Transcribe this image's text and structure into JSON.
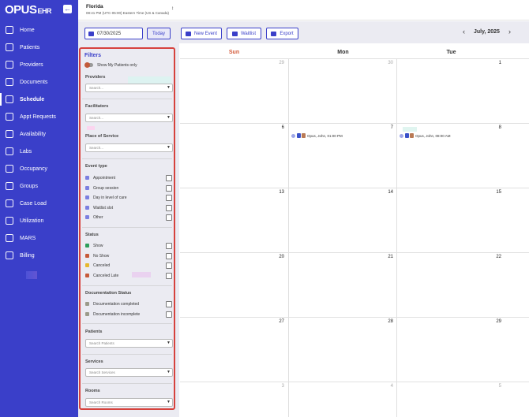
{
  "sidebar": {
    "logo": "OPUS",
    "logo_suffix": "EHR",
    "collapse_icon": "arrow-left-icon",
    "items": [
      {
        "label": "Home",
        "icon": "home-icon"
      },
      {
        "label": "Patients",
        "icon": "patients-icon"
      },
      {
        "label": "Providers",
        "icon": "providers-icon"
      },
      {
        "label": "Documents",
        "icon": "documents-icon"
      },
      {
        "label": "Schedule",
        "icon": "calendar-icon",
        "active": true
      },
      {
        "label": "Appt Requests",
        "icon": "appt-requests-icon"
      },
      {
        "label": "Availability",
        "icon": "clock-icon"
      },
      {
        "label": "Labs",
        "icon": "flask-icon"
      },
      {
        "label": "Occupancy",
        "icon": "bed-icon"
      },
      {
        "label": "Groups",
        "icon": "groups-icon"
      },
      {
        "label": "Case Load",
        "icon": "case-load-icon"
      },
      {
        "label": "Utilization",
        "icon": "utilization-icon"
      },
      {
        "label": "MARS",
        "icon": "pill-icon"
      },
      {
        "label": "Billing",
        "icon": "billing-icon"
      }
    ]
  },
  "header": {
    "location": "Florida",
    "time": "08:41 PM (UTC-05:00) Eastern Time (US & Canada)"
  },
  "toolbar": {
    "date": "07/30/2025",
    "today": "Today",
    "new_event": "New Event",
    "waitlist": "Waitlist",
    "export": "Export",
    "month": "July, 2025"
  },
  "filters": {
    "title": "Filters",
    "show_my_patients": "Show My Patients only",
    "providers": {
      "label": "Providers",
      "placeholder": "Search..."
    },
    "facilitators": {
      "label": "Facilitators",
      "placeholder": "Search..."
    },
    "place_of_service": {
      "label": "Place of Service",
      "placeholder": "Search..."
    },
    "event_type": {
      "label": "Event type",
      "items": [
        {
          "label": "Appointment",
          "color": "#7b7fe0"
        },
        {
          "label": "Group session",
          "color": "#7b7fe0"
        },
        {
          "label": "Day in level of care",
          "color": "#7b7fe0"
        },
        {
          "label": "Waitlist slot",
          "color": "#7b7fe0"
        },
        {
          "label": "Other",
          "color": "#7b7fe0"
        }
      ]
    },
    "status": {
      "label": "Status",
      "items": [
        {
          "label": "Show",
          "color": "#2e9e5b"
        },
        {
          "label": "No Show",
          "color": "#c65a3a"
        },
        {
          "label": "Canceled",
          "color": "#e6b82e"
        },
        {
          "label": "Canceled Late",
          "color": "#c65a3a"
        }
      ]
    },
    "documentation_status": {
      "label": "Documentation Status",
      "items": [
        {
          "label": "Documentation completed",
          "color": "#9b9b8a"
        },
        {
          "label": "Documentation incomplete",
          "color": "#9b9b8a"
        }
      ]
    },
    "patients": {
      "label": "Patients",
      "placeholder": "Search Patients"
    },
    "services": {
      "label": "Services",
      "placeholder": "Search Services"
    },
    "rooms": {
      "label": "Rooms",
      "placeholder": "Search Rooms"
    }
  },
  "calendar": {
    "days_of_week": [
      {
        "label": "Sun",
        "color": "#d35a3a"
      },
      {
        "label": "Mon",
        "color": "#333333"
      },
      {
        "label": "Tue",
        "color": "#333333"
      }
    ],
    "weeks": [
      [
        {
          "day": "29",
          "muted": true
        },
        {
          "day": "30",
          "muted": true
        },
        {
          "day": "1",
          "muted": false
        }
      ],
      [
        {
          "day": "6",
          "muted": false
        },
        {
          "day": "7",
          "muted": false
        },
        {
          "day": "8",
          "muted": false
        }
      ],
      [
        {
          "day": "13",
          "muted": false
        },
        {
          "day": "14",
          "muted": false
        },
        {
          "day": "15",
          "muted": false
        }
      ],
      [
        {
          "day": "20",
          "muted": false
        },
        {
          "day": "21",
          "muted": false
        },
        {
          "day": "22",
          "muted": false
        }
      ],
      [
        {
          "day": "27",
          "muted": false
        },
        {
          "day": "28",
          "muted": false
        },
        {
          "day": "29",
          "muted": false
        }
      ],
      [
        {
          "day": "3",
          "muted": true
        },
        {
          "day": "4",
          "muted": true
        },
        {
          "day": "5",
          "muted": true
        }
      ]
    ],
    "events": [
      {
        "week": 1,
        "day": 1,
        "text": "Opus, John, 01:00 PM"
      },
      {
        "week": 1,
        "day": 2,
        "text": "Opus, John, 08:00 AM"
      }
    ]
  }
}
